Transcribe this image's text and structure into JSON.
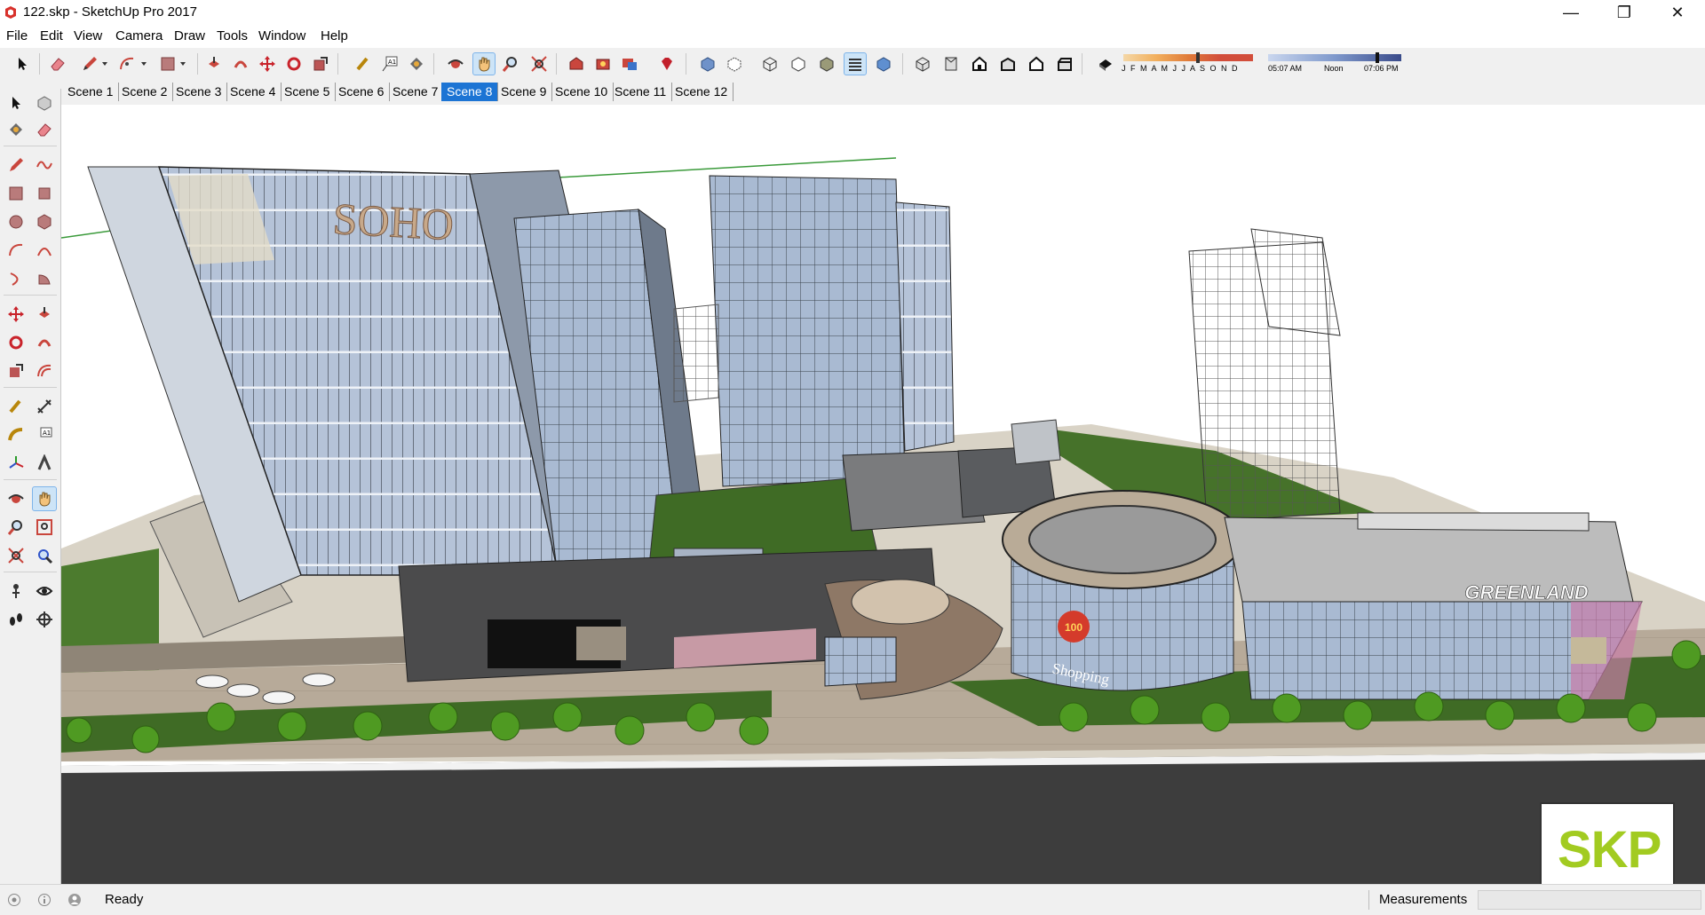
{
  "window": {
    "title": "122.skp - SketchUp Pro 2017",
    "controls": {
      "minimize": "—",
      "maximize": "❐",
      "close": "✕"
    }
  },
  "menu": [
    "File",
    "Edit",
    "View",
    "Camera",
    "Draw",
    "Tools",
    "Window",
    "Help"
  ],
  "toolbar": {
    "active_tool": "walk-tool",
    "shadow_panel": {
      "months": "J F M A M J J A S O N D",
      "time_start": "05:07 AM",
      "time_mid": "Noon",
      "time_end": "07:06 PM"
    }
  },
  "scenes": {
    "tabs": [
      "Scene 1",
      "Scene 2",
      "Scene 3",
      "Scene 4",
      "Scene 5",
      "Scene 6",
      "Scene 7",
      "Scene 8",
      "Scene 9",
      "Scene 10",
      "Scene 11",
      "Scene 12"
    ],
    "active": "Scene 8"
  },
  "model": {
    "signs": {
      "tower": "SOHO",
      "mall": "GREENLAND",
      "rotunda": "Shopping",
      "medallion": "100"
    }
  },
  "badge": {
    "text": "SKP",
    "color": "#a2cb21"
  },
  "status": {
    "text": "Ready",
    "measurements_label": "Measurements",
    "measurements_value": ""
  },
  "colors": {
    "active_tab": "#1c74d4",
    "grass": "#3f6b25",
    "glass": "#aabbd2",
    "tree": "#4f9a22"
  }
}
